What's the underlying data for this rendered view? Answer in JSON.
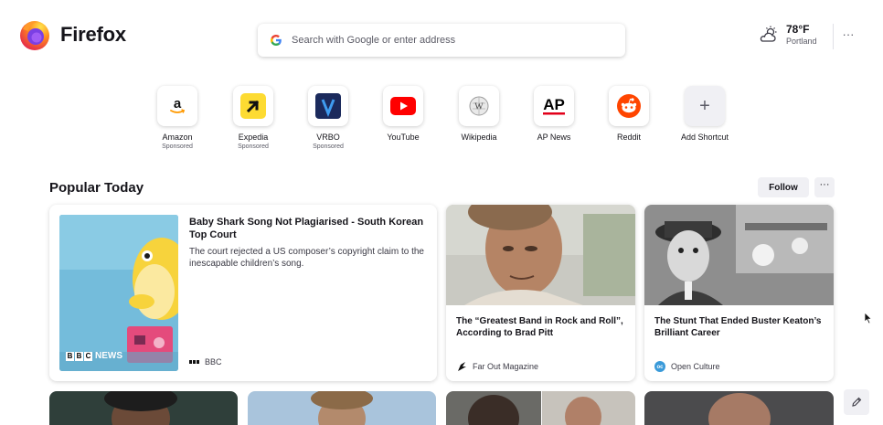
{
  "brand": {
    "name": "Firefox"
  },
  "search": {
    "placeholder": "Search with Google or enter address"
  },
  "weather": {
    "temp": "78°F",
    "location": "Portland"
  },
  "shortcuts": [
    {
      "label": "Amazon",
      "sub": "Sponsored",
      "icon": "amazon-icon"
    },
    {
      "label": "Expedia",
      "sub": "Sponsored",
      "icon": "expedia-icon"
    },
    {
      "label": "VRBO",
      "sub": "Sponsored",
      "icon": "vrbo-icon"
    },
    {
      "label": "YouTube",
      "sub": "",
      "icon": "youtube-icon"
    },
    {
      "label": "Wikipedia",
      "sub": "",
      "icon": "wikipedia-icon"
    },
    {
      "label": "AP News",
      "sub": "",
      "icon": "ap-news-icon"
    },
    {
      "label": "Reddit",
      "sub": "",
      "icon": "reddit-icon"
    },
    {
      "label": "Add Shortcut",
      "sub": "",
      "icon": "plus-icon"
    }
  ],
  "section": {
    "title": "Popular Today",
    "follow": "Follow",
    "more": "···"
  },
  "stories": [
    {
      "title": "Baby Shark Song Not Plagiarised - South Korean Top Court",
      "description": "The court rejected a US composer’s copyright claim to the inescapable children’s song.",
      "source": "BBC",
      "image_caption": "BBC NEWS"
    },
    {
      "title": "The “Greatest Band in Rock and Roll”, According to Brad Pitt",
      "source": "Far Out Magazine"
    },
    {
      "title": "The Stunt That Ended Buster Keaton’s Brilliant Career",
      "source": "Open Culture"
    }
  ],
  "colors": {
    "accent": "#0061e0",
    "text": "#15141a",
    "muted": "#5b5b66",
    "button_bg": "#f0f0f4"
  }
}
